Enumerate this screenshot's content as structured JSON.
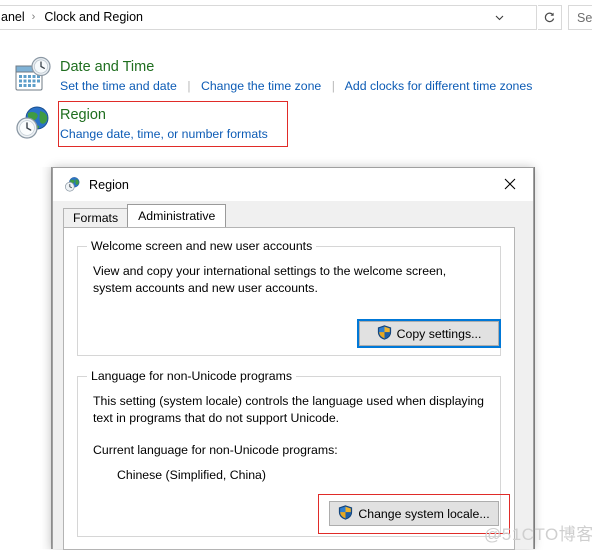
{
  "window": {
    "breadcrumb": {
      "first": "anel",
      "separator": "›",
      "last": "Clock and Region"
    },
    "chevron_icon": "chevron-down-icon",
    "refresh_icon": "refresh-icon",
    "search_placeholder": "Search"
  },
  "items": [
    {
      "icon": "calendar-clock-icon",
      "title": "Date and Time",
      "links": [
        "Set the time and date",
        "Change the time zone",
        "Add clocks for different time zones"
      ]
    },
    {
      "icon": "globe-clock-icon",
      "title": "Region",
      "links": [
        "Change date, time, or number formats"
      ]
    }
  ],
  "dialog": {
    "icon": "globe-clock-icon",
    "title": "Region",
    "close_icon": "close-icon",
    "tabs": [
      {
        "label": "Formats",
        "active": false
      },
      {
        "label": "Administrative",
        "active": true
      }
    ],
    "welcome_group": {
      "legend": "Welcome screen and new user accounts",
      "description": "View and copy your international settings to the welcome screen, system accounts and new user accounts.",
      "button": {
        "label": "Copy settings...",
        "icon": "uac-shield-icon",
        "focused": true
      }
    },
    "language_group": {
      "legend": "Language for non-Unicode programs",
      "description": "This setting (system locale) controls the language used when displaying text in programs that do not support Unicode.",
      "current_label": "Current language for non-Unicode programs:",
      "current_value": "Chinese (Simplified, China)",
      "button": {
        "label": "Change system locale...",
        "icon": "uac-shield-icon",
        "highlighted": true
      }
    }
  },
  "annotations": {
    "color": "#e02b28",
    "region_item": "Region",
    "locale_button": "Change system locale..."
  },
  "watermark": "@51CTO博客"
}
